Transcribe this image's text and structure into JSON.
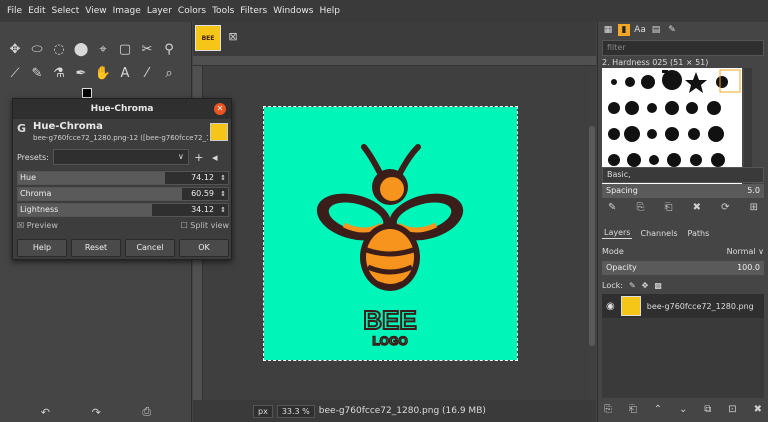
{
  "menu": [
    "File",
    "Edit",
    "Select",
    "View",
    "Image",
    "Layer",
    "Colors",
    "Tools",
    "Filters",
    "Windows",
    "Help"
  ],
  "toolbox": {
    "row1": [
      "✥",
      "⬭",
      "◌",
      "⬤",
      "⌖",
      "▢",
      "✂",
      "⚲"
    ],
    "row2": [
      "⟋",
      "✎",
      "⚗",
      "✒",
      "✋",
      "A",
      "⁄",
      "⌕"
    ],
    "footer": [
      "↶",
      "↷",
      "⎙"
    ]
  },
  "image_tab": {
    "thumb_text": "BEE",
    "close": "⊠"
  },
  "status": {
    "unit": "px",
    "zoom": "33.3 %",
    "file": "bee-g760fcce72_1280.png (16.9 MB)"
  },
  "dock": {
    "filter_placeholder": "filter",
    "brush_name": "2. Hardness 025 (51 × 51)",
    "preset": "Basic,",
    "spacing_label": "Spacing",
    "spacing_value": "5.0",
    "brush_actions": [
      "✎",
      "⎘",
      "⎗",
      "✖",
      "⟳",
      "⊞"
    ],
    "layer_tabs": [
      "Layers",
      "Channels",
      "Paths"
    ],
    "mode_label": "Mode",
    "mode_value": "Normal ∨",
    "opacity_label": "Opacity",
    "opacity_value": "100.0",
    "lock_label": "Lock:",
    "layer_name": "bee-g760fcce72_1280.png",
    "layer_actions": [
      "⎘",
      "⎗",
      "⌃",
      "⌄",
      "⧉",
      "⊡",
      "✖"
    ]
  },
  "dialog": {
    "title": "Hue-Chroma",
    "heading": "Hue-Chroma",
    "subtitle": "bee-g760fcce72_1280.png-12 ([bee-g760fcce72_1280.png] (im",
    "presets_label": "Presets:",
    "sliders": [
      {
        "label": "Hue",
        "value": "74.12",
        "fill": 0.7
      },
      {
        "label": "Chroma",
        "value": "60.59",
        "fill": 0.78
      },
      {
        "label": "Lightness",
        "value": "34.12",
        "fill": 0.64
      }
    ],
    "preview_label": "Preview",
    "split_label": "Split view",
    "buttons": [
      "Help",
      "Reset",
      "Cancel",
      "OK"
    ]
  },
  "logo": {
    "word1": "BEE",
    "word2": "LOGO"
  },
  "colors": {
    "canvas": "#00f6b8",
    "bee_dark": "#3b1d1a",
    "bee_orange": "#f7941d",
    "accent": "#f5a623"
  }
}
